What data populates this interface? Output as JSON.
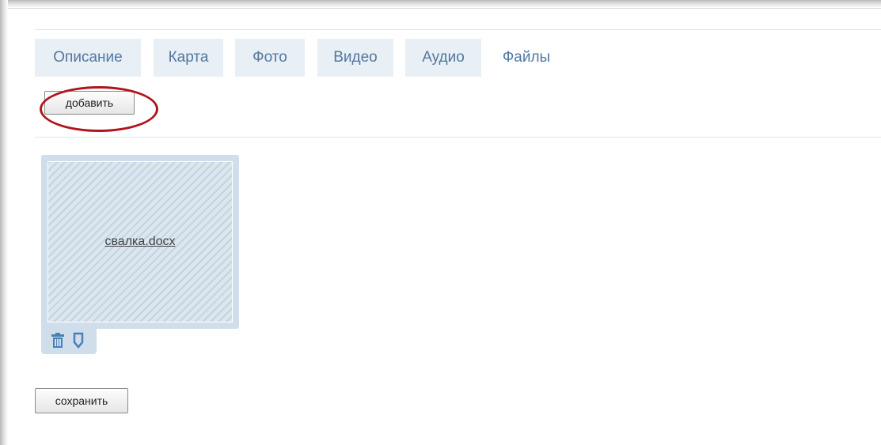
{
  "tabs": [
    {
      "label": "Описание",
      "active": false
    },
    {
      "label": "Карта",
      "active": false
    },
    {
      "label": "Фото",
      "active": false
    },
    {
      "label": "Видео",
      "active": false
    },
    {
      "label": "Аудио",
      "active": false
    },
    {
      "label": "Файлы",
      "active": true
    }
  ],
  "toolbar": {
    "add_label": "добавить"
  },
  "files": [
    {
      "name": "свалка.docx"
    }
  ],
  "file_actions": {
    "delete_icon": "trash-icon",
    "edit_icon": "pin-icon"
  },
  "footer": {
    "save_label": "сохранить"
  },
  "colors": {
    "tab_text": "#5278a0",
    "tab_bg": "#e8eff5",
    "card_bg": "#cfdeea",
    "icon_blue": "#4a7fb8",
    "highlight": "#b0151c"
  }
}
